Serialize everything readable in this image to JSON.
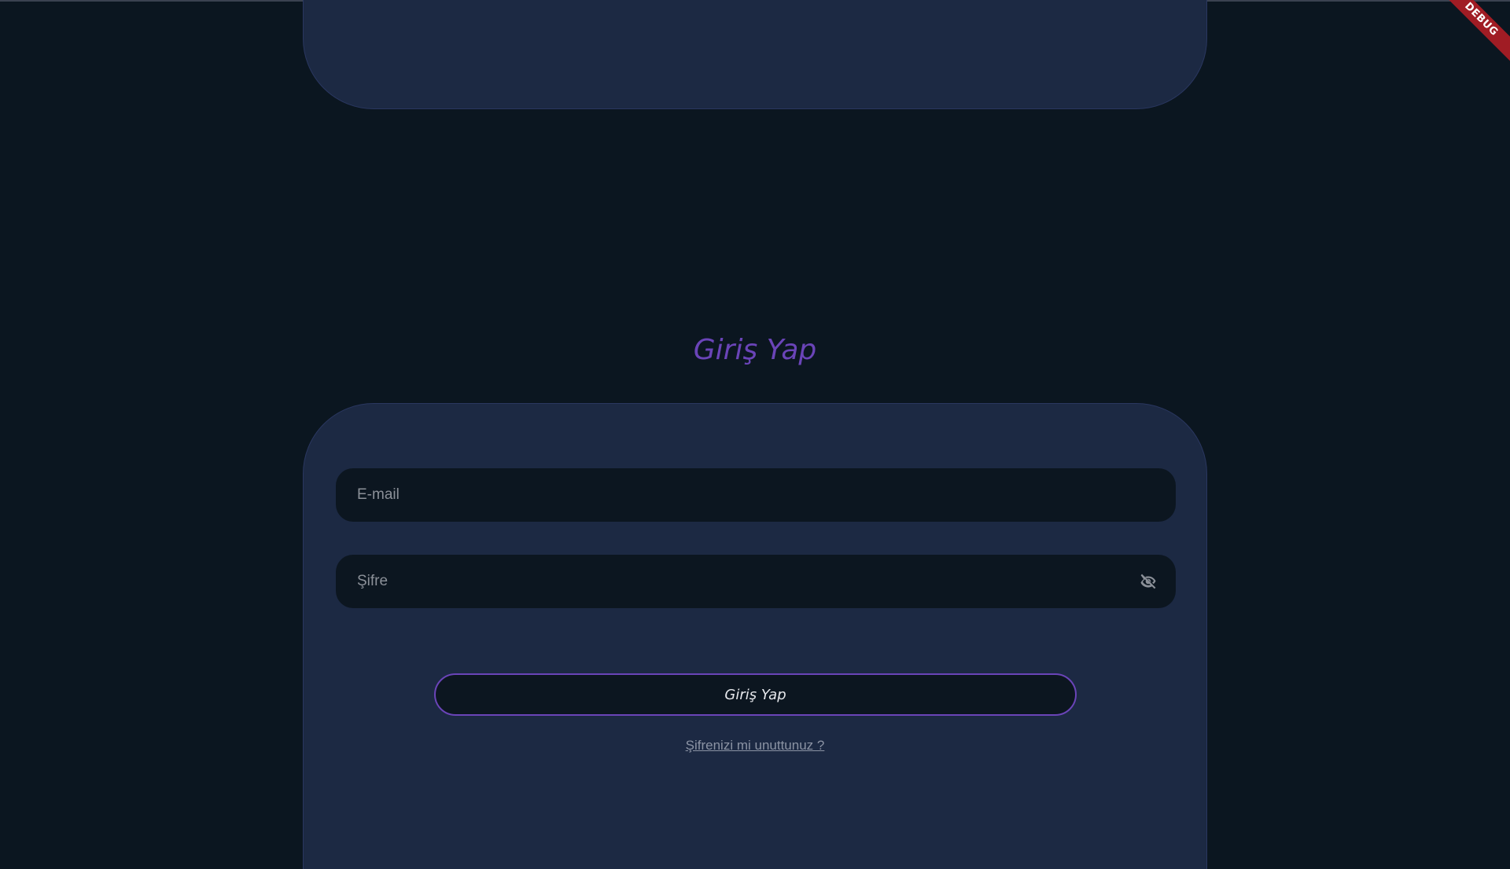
{
  "header": {
    "title": "Giriş Yap"
  },
  "form": {
    "email_placeholder": "E-mail",
    "password_placeholder": "Şifre",
    "visibility_icon": "eye-off-icon",
    "submit_label": "Giriş Yap",
    "forgot_password_label": "Şifrenizi mi unuttunuz ?"
  },
  "debug_banner": {
    "label": "DEBUG"
  },
  "colors": {
    "background": "#0b1620",
    "card": "#1c2943",
    "field": "#0c1620",
    "accent": "#6a44b8",
    "debug": "#a01c24"
  }
}
